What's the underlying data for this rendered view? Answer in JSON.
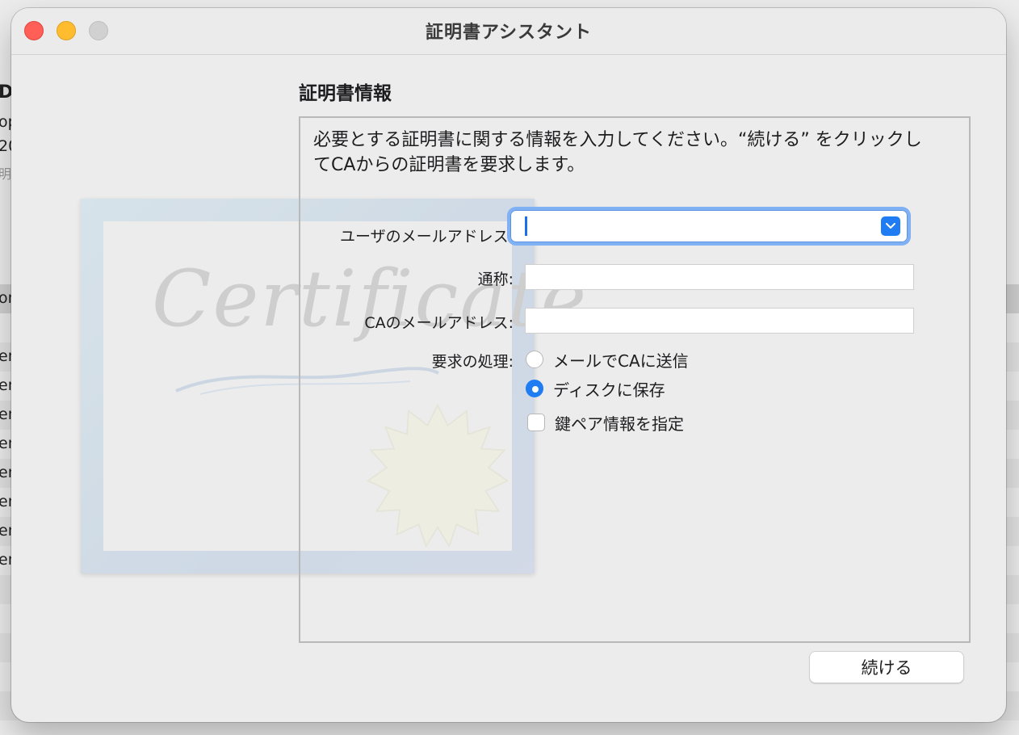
{
  "background_app": {
    "left_texts": [
      {
        "text": "D"
      },
      {
        "text": "op"
      },
      {
        "text": "20"
      },
      {
        "text": "明報"
      },
      {
        "text": "on"
      },
      {
        "text": "en"
      },
      {
        "text": "en"
      },
      {
        "text": "en"
      },
      {
        "text": "en"
      },
      {
        "text": "en"
      },
      {
        "text": "en"
      },
      {
        "text": "en"
      },
      {
        "text": "en"
      }
    ]
  },
  "window": {
    "title": "証明書アシスタント",
    "traffic_lights": {
      "close": "#ff5f57",
      "minimize": "#febc2e",
      "zoom": "#d1d1d1"
    }
  },
  "illustration": {
    "word": "Certificate"
  },
  "section": {
    "title": "証明書情報",
    "description": "必要とする証明書に関する情報を入力してください。“続ける” をクリックしてCAからの証明書を要求します。"
  },
  "form": {
    "email_label": "ユーザのメールアドレス:",
    "email_value": "",
    "common_name_label": "通称:",
    "common_name_value": "",
    "ca_email_label": "CAのメールアドレス:",
    "ca_email_value": "",
    "request_label": "要求の処理:",
    "radio_options": [
      {
        "label": "メールでCAに送信",
        "selected": false
      },
      {
        "label": "ディスクに保存",
        "selected": true
      }
    ],
    "checkbox_label": "鍵ペア情報を指定",
    "checkbox_checked": false
  },
  "footer": {
    "continue_label": "続ける"
  },
  "colors": {
    "accent": "#1f7cf3",
    "focus_ring": "#7fb1f4"
  }
}
